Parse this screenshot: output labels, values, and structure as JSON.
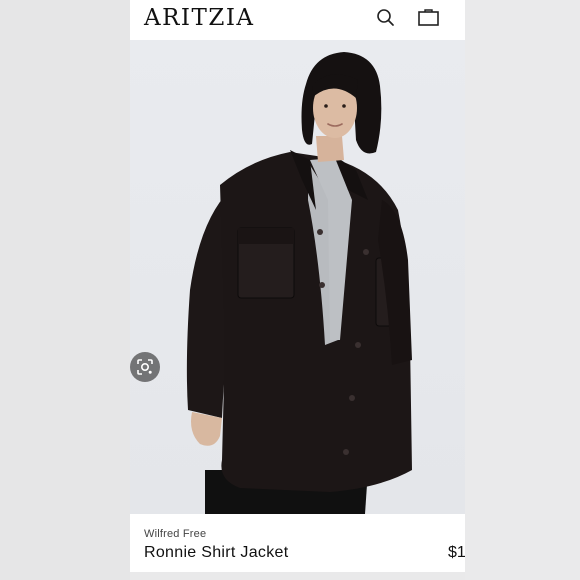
{
  "header": {
    "brand": "ARITZIA",
    "search_icon": "search-icon",
    "bag_icon": "shopping-bag-icon"
  },
  "hero": {
    "image_subject": "model wearing black oversized shirt jacket over grey tee",
    "lens_icon": "visual-search-icon"
  },
  "product": {
    "designer": "Wilfred Free",
    "name": "Ronnie Shirt Jacket",
    "price": "$1"
  },
  "colors": {
    "background": "#e9e9ea",
    "jacket": "#1c1616",
    "tee": "#b9bcc0",
    "text": "#111111"
  }
}
